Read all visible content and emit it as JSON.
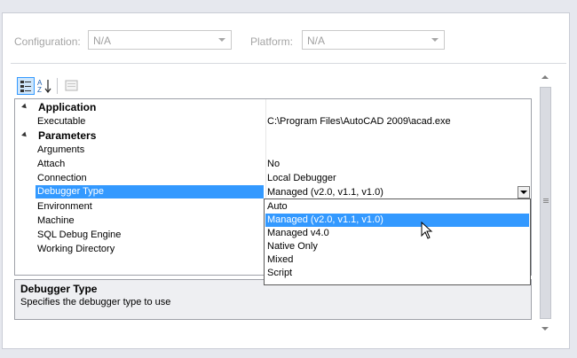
{
  "config": {
    "configuration_label": "Configuration:",
    "configuration_value": "N/A",
    "platform_label": "Platform:",
    "platform_value": "N/A"
  },
  "toolbar": {
    "categorized_icon": "categorized-view-icon",
    "alphabetical_icon": "sort-alphabetical-icon",
    "property_pages_icon": "property-pages-icon"
  },
  "grid": {
    "cat_application": "Application",
    "executable_name": "Executable",
    "executable_value": "C:\\Program Files\\AutoCAD 2009\\acad.exe",
    "cat_parameters": "Parameters",
    "arguments_name": "Arguments",
    "attach_name": "Attach",
    "attach_value": "No",
    "connection_name": "Connection",
    "connection_value": "Local Debugger",
    "debugger_type_name": "Debugger Type",
    "debugger_type_value": "Managed (v2.0, v1.1, v1.0)",
    "environment_name": "Environment",
    "machine_name": "Machine",
    "sql_name": "SQL Debug Engine",
    "working_dir_name": "Working Directory"
  },
  "dropdown": {
    "options": [
      "Auto",
      "Managed (v2.0, v1.1, v1.0)",
      "Managed v4.0",
      "Native Only",
      "Mixed",
      "Script"
    ],
    "highlighted": "Managed (v2.0, v1.1, v1.0)"
  },
  "description": {
    "title": "Debugger Type",
    "text": "Specifies the debugger type to use"
  },
  "colors": {
    "selection": "#3399ff",
    "panel_bg": "#ffffff",
    "desc_bg": "#eeeff2"
  }
}
